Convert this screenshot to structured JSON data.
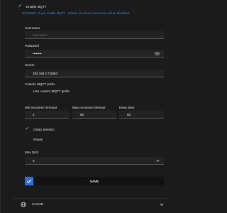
{
  "enable_mqtt": {
    "label": "Enable MQTT",
    "checked": true
  },
  "warning": "WARNING: If you enable MQTT - actions via Cloud connection will be disabled!",
  "username": {
    "label": "Username",
    "placeholder": "Username",
    "value": ""
  },
  "password": {
    "label": "Password",
    "value": "••••••••"
  },
  "server": {
    "label": "Server",
    "value": "192.168.2.7[1883"
  },
  "custom_prefix": {
    "label": "Custom MQTT prefix",
    "checkbox_label": "Use custom MQTT prefix",
    "checked": false
  },
  "min_reconnect": {
    "label": "Min reconnect timeout",
    "value": "2"
  },
  "max_reconnect": {
    "label": "Max reconnect timeout",
    "value": "60"
  },
  "keep_alive": {
    "label": "Keep alive",
    "value": "60"
  },
  "clean_session": {
    "label": "Clean Session",
    "checked": true
  },
  "retain": {
    "label": "Retain",
    "checked": false
  },
  "max_qos": {
    "label": "Max QoS",
    "value": "0"
  },
  "save_label": "SAVE",
  "footer": {
    "label": "CLOUD",
    "icon": "globe-icon"
  },
  "colors": {
    "accent": "#2f6fd6",
    "warning": "#2d8ae0",
    "background": "#1b1b1b"
  }
}
